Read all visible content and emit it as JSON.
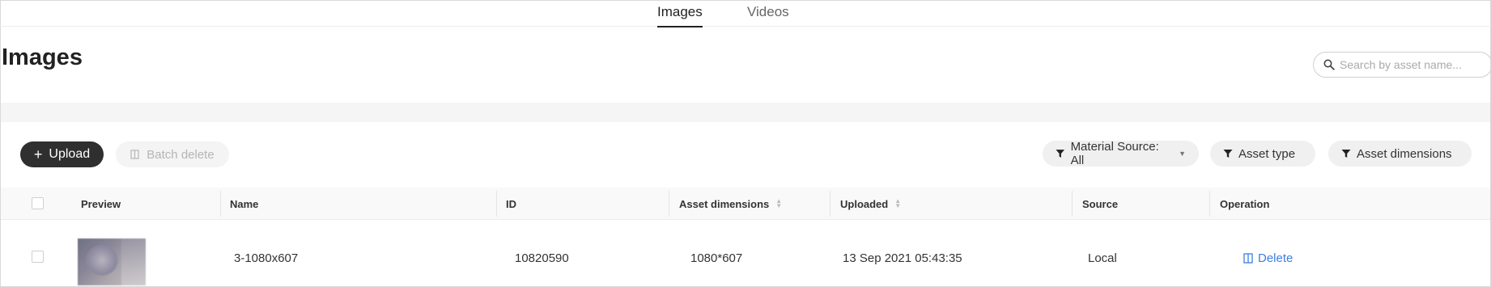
{
  "tabs": [
    {
      "label": "Images",
      "active": true
    },
    {
      "label": "Videos",
      "active": false
    }
  ],
  "page": {
    "title": "Images"
  },
  "search": {
    "placeholder": "Search by asset name...",
    "value": ""
  },
  "toolbar": {
    "upload_label": "Upload",
    "batch_delete_label": "Batch delete"
  },
  "filters": {
    "material_source": "Material Source: All",
    "asset_type": "Asset type",
    "asset_dimensions": "Asset dimensions"
  },
  "table": {
    "columns": [
      "Preview",
      "Name",
      "ID",
      "Asset dimensions",
      "Uploaded",
      "Source",
      "Operation"
    ],
    "rows": [
      {
        "name": "3-1080x607",
        "id": "10820590",
        "dimensions": "1080*607",
        "uploaded": "13 Sep 2021 05:43:35",
        "source": "Local",
        "operation": "Delete"
      }
    ]
  },
  "colors": {
    "accent": "#3d7fe0",
    "primary_button": "#2f2f2f"
  }
}
